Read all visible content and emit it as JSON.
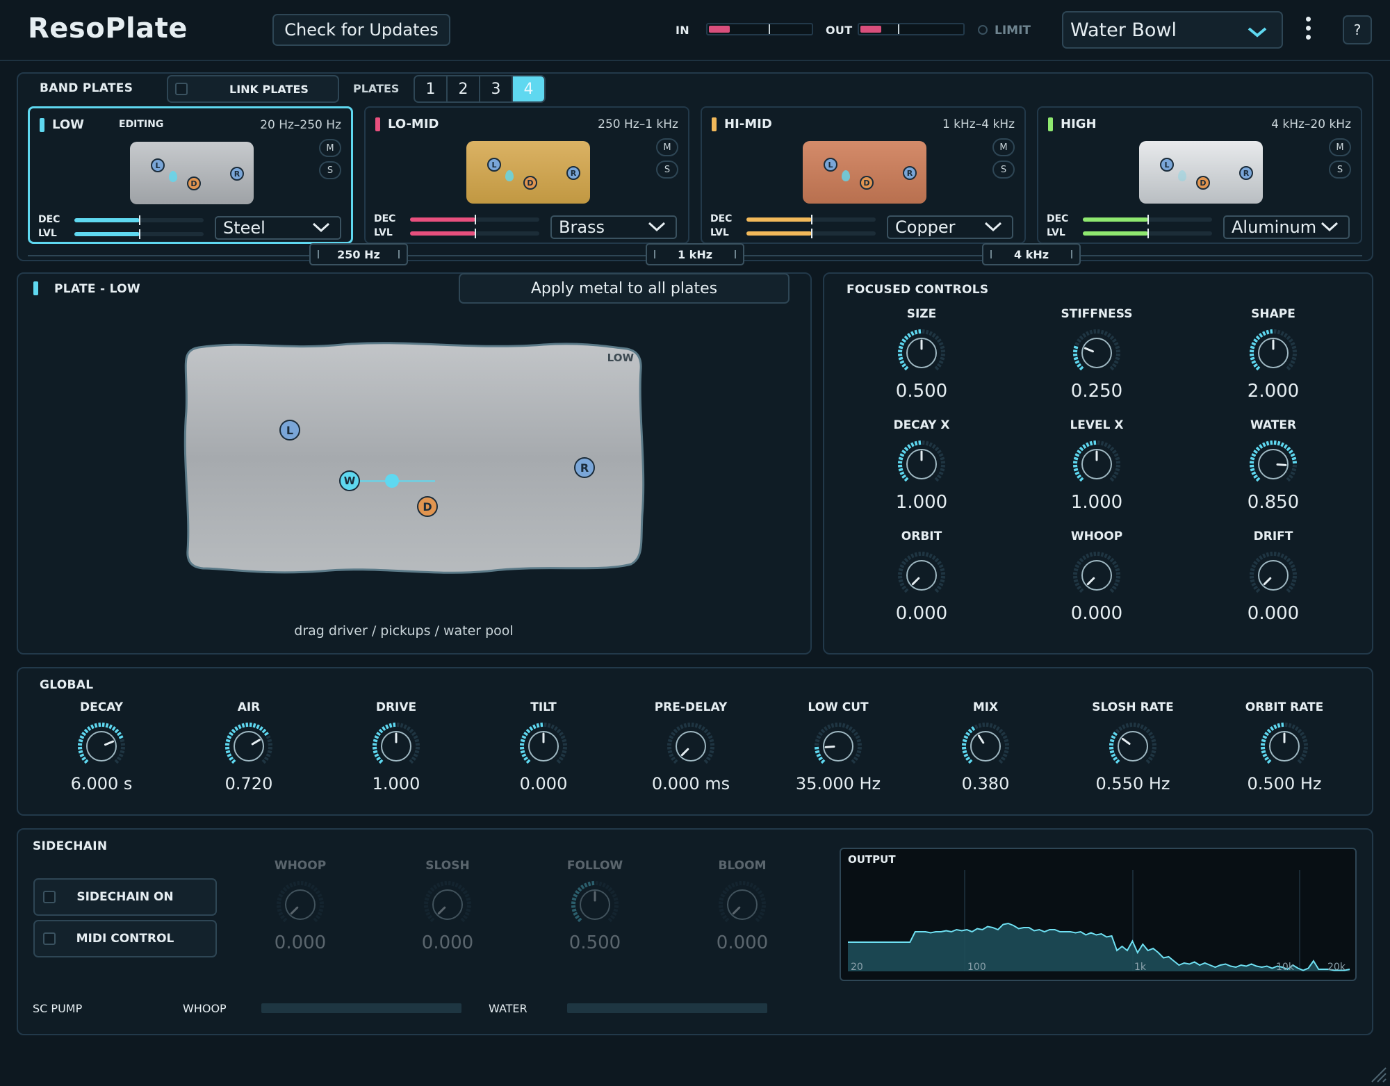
{
  "app": {
    "title": "ResoPlate",
    "update_label": "Check for Updates",
    "in_label": "IN",
    "out_label": "OUT",
    "limit_label": "LIMIT",
    "preset": "Water Bowl",
    "help": "?"
  },
  "meters": {
    "in_level": 0.2,
    "out_level": 0.2
  },
  "bands": {
    "title": "BAND PLATES",
    "link_label": "LINK PLATES",
    "plates_label": "PLATES",
    "plate_buttons": [
      "1",
      "2",
      "3",
      "4"
    ],
    "active_plate": "4",
    "items": [
      {
        "name": "LOW",
        "range": "20 Hz–250 Hz",
        "editing": "EDITING",
        "m": "M",
        "s": "S",
        "dec": "DEC",
        "lvl": "LVL",
        "metal": "Steel",
        "color": "#5fd8f0",
        "dec_value": 0.5,
        "lvl_value": 0.5
      },
      {
        "name": "LO-MID",
        "range": "250 Hz–1 kHz",
        "m": "M",
        "s": "S",
        "dec": "DEC",
        "lvl": "LVL",
        "metal": "Brass",
        "color": "#e8507e",
        "dec_value": 0.5,
        "lvl_value": 0.5
      },
      {
        "name": "HI-MID",
        "range": "1 kHz–4 kHz",
        "m": "M",
        "s": "S",
        "dec": "DEC",
        "lvl": "LVL",
        "metal": "Copper",
        "color": "#f2b95a",
        "dec_value": 0.5,
        "lvl_value": 0.5
      },
      {
        "name": "HIGH",
        "range": "4 kHz–20 kHz",
        "m": "M",
        "s": "S",
        "dec": "DEC",
        "lvl": "LVL",
        "metal": "Aluminum",
        "color": "#8fe870",
        "dec_value": 0.5,
        "lvl_value": 0.5
      }
    ],
    "crossovers": [
      "250 Hz",
      "1 kHz",
      "4 kHz"
    ]
  },
  "plate": {
    "title": "PLATE - LOW",
    "apply_label": "Apply metal to all plates",
    "corner": "LOW",
    "hint": "drag driver / pickups / water pool",
    "pins": {
      "L": "L",
      "R": "R",
      "W": "W",
      "D": "D"
    }
  },
  "focused": {
    "title": "FOCUSED CONTROLS",
    "knobs": [
      {
        "label": "SIZE",
        "value": "0.500",
        "norm": 0.5
      },
      {
        "label": "STIFFNESS",
        "value": "0.250",
        "norm": 0.25
      },
      {
        "label": "SHAPE",
        "value": "2.000",
        "norm": 0.5
      },
      {
        "label": "DECAY X",
        "value": "1.000",
        "norm": 0.5
      },
      {
        "label": "LEVEL X",
        "value": "1.000",
        "norm": 0.5
      },
      {
        "label": "WATER",
        "value": "0.850",
        "norm": 0.85
      },
      {
        "label": "ORBIT",
        "value": "0.000",
        "norm": 0
      },
      {
        "label": "WHOOP",
        "value": "0.000",
        "norm": 0
      },
      {
        "label": "DRIFT",
        "value": "0.000",
        "norm": 0
      }
    ]
  },
  "global": {
    "title": "GLOBAL",
    "knobs": [
      {
        "label": "DECAY",
        "value": "6.000 s",
        "norm": 0.75
      },
      {
        "label": "AIR",
        "value": "0.720",
        "norm": 0.72
      },
      {
        "label": "DRIVE",
        "value": "1.000",
        "norm": 0.5
      },
      {
        "label": "TILT",
        "value": "0.000",
        "norm": 0.5
      },
      {
        "label": "PRE-DELAY",
        "value": "0.000 ms",
        "norm": 0
      },
      {
        "label": "LOW CUT",
        "value": "35.000 Hz",
        "norm": 0.15
      },
      {
        "label": "MIX",
        "value": "0.380",
        "norm": 0.38
      },
      {
        "label": "SLOSH RATE",
        "value": "0.550 Hz",
        "norm": 0.3
      },
      {
        "label": "ORBIT RATE",
        "value": "0.500 Hz",
        "norm": 0.5
      }
    ]
  },
  "sidechain": {
    "title": "SIDECHAIN",
    "on_label": "SIDECHAIN ON",
    "midi_label": "MIDI CONTROL",
    "knobs": [
      {
        "label": "WHOOP",
        "value": "0.000",
        "norm": 0
      },
      {
        "label": "SLOSH",
        "value": "0.000",
        "norm": 0
      },
      {
        "label": "FOLLOW",
        "value": "0.500",
        "norm": 0.5
      },
      {
        "label": "BLOOM",
        "value": "0.000",
        "norm": 0
      }
    ],
    "pump_label": "SC PUMP",
    "whoop_label": "WHOOP",
    "water_label": "WATER"
  },
  "output": {
    "title": "OUTPUT",
    "ticks": [
      "20",
      "100",
      "1k",
      "10k",
      "20k"
    ],
    "spectrum": [
      0.28,
      0.28,
      0.28,
      0.28,
      0.28,
      0.28,
      0.28,
      0.28,
      0.28,
      0.28,
      0.28,
      0.28,
      0.28,
      0.38,
      0.38,
      0.38,
      0.37,
      0.38,
      0.38,
      0.39,
      0.38,
      0.4,
      0.39,
      0.4,
      0.38,
      0.41,
      0.4,
      0.43,
      0.42,
      0.4,
      0.45,
      0.46,
      0.44,
      0.41,
      0.42,
      0.42,
      0.39,
      0.4,
      0.38,
      0.4,
      0.4,
      0.38,
      0.38,
      0.38,
      0.37,
      0.38,
      0.35,
      0.37,
      0.35,
      0.36,
      0.33,
      0.34,
      0.2,
      0.24,
      0.2,
      0.29,
      0.18,
      0.26,
      0.2,
      0.22,
      0.18,
      0.13,
      0.14,
      0.1,
      0.06,
      0.08,
      0.07,
      0.09,
      0.06,
      0.08,
      0.06,
      0.04,
      0.06,
      0.07,
      0.05,
      0.04,
      0.06,
      0.05,
      0.07,
      0.05,
      0.04,
      0.05,
      0.03,
      0.05,
      0.04,
      0.02,
      0.06,
      0.03,
      0.01,
      0.03,
      0.1,
      0.02,
      0.02,
      0.02,
      0.01,
      0.01,
      0.01,
      0.02
    ]
  }
}
